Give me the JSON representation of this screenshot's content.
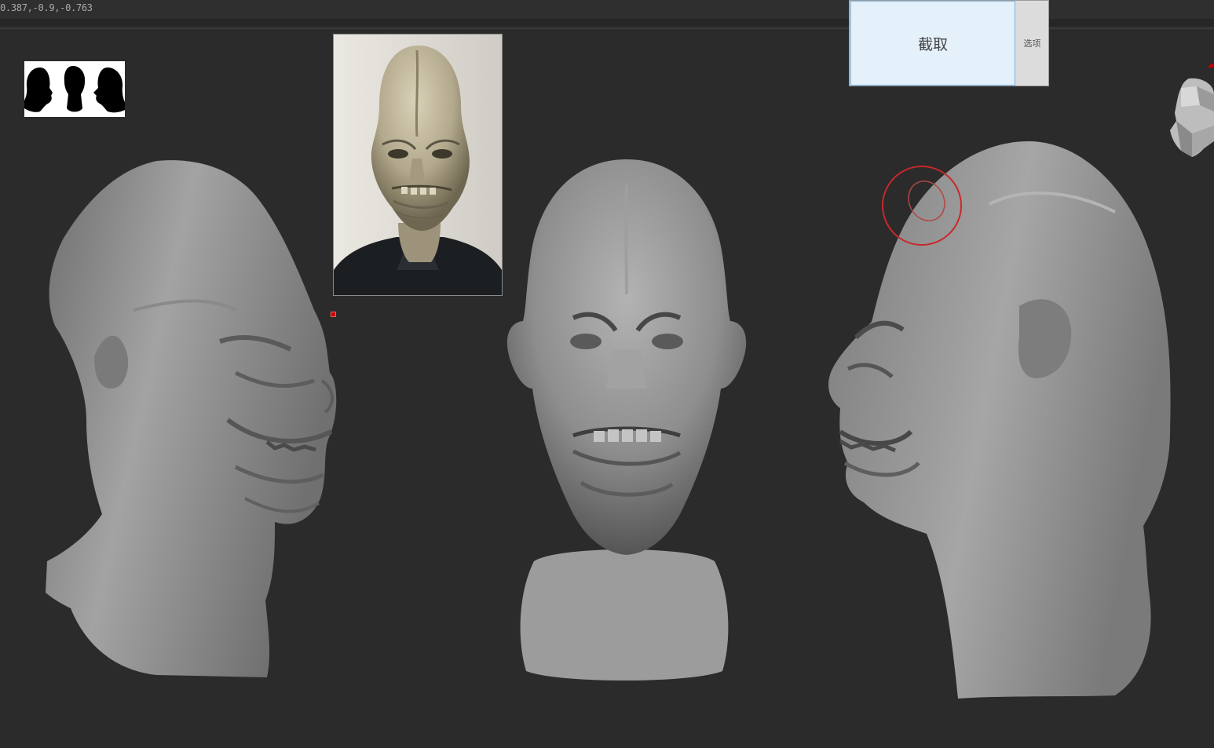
{
  "viewport": {
    "coordinates_readout": "0.387,-0.9,-0.763"
  },
  "capture_tool": {
    "capture_label": "截取",
    "options_label": "选项"
  },
  "icons": {
    "silhouette_strip": "head-silhouettes-icon",
    "nav_cube": "navigation-head-icon",
    "brush": "brush-cursor-icon"
  },
  "colors": {
    "background": "#2b2b2b",
    "sculpt_clay": "#8e8e8e",
    "capture_button_bg": "#e4f0fa",
    "brush_ring": "#c8282a"
  }
}
